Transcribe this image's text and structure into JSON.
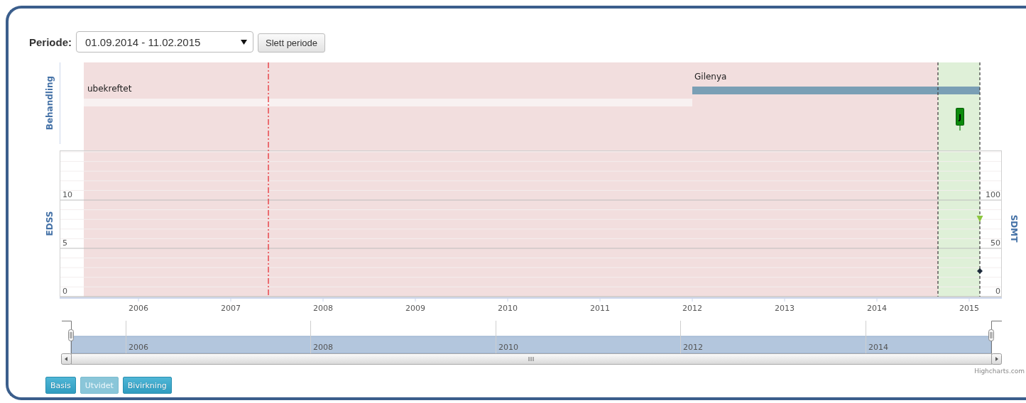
{
  "period": {
    "label": "Periode:",
    "value": "01.09.2014 - 11.02.2015",
    "delete_button": "Slett periode"
  },
  "timeline_chart": {
    "treatment_axis_title": "Behandling",
    "treatments": [
      {
        "label": "ubekreftet",
        "kind": "unconfirmed"
      },
      {
        "label": "Gilenya",
        "kind": "drug"
      }
    ],
    "event_marker": {
      "label": "J"
    },
    "left_axis": {
      "title": "EDSS",
      "ticks": [
        "10",
        "5",
        "0"
      ]
    },
    "right_axis": {
      "title": "SDMT",
      "ticks": [
        "100",
        "50",
        "0"
      ]
    },
    "x_labels": [
      "2006",
      "2007",
      "2008",
      "2009",
      "2010",
      "2011",
      "2012",
      "2013",
      "2014",
      "2015"
    ],
    "points": [
      {
        "kind": "triangle",
        "color": "#8cc63f"
      },
      {
        "kind": "diamond",
        "color": "#1c2a3a"
      }
    ],
    "navigator_labels": [
      "2006",
      "2008",
      "2010",
      "2012",
      "2014"
    ],
    "credits": "Highcharts.com"
  },
  "view_buttons": [
    {
      "label": "Basis",
      "selected": false
    },
    {
      "label": "Utvidet",
      "selected": true
    },
    {
      "label": "Bivirkning",
      "selected": false
    }
  ]
}
